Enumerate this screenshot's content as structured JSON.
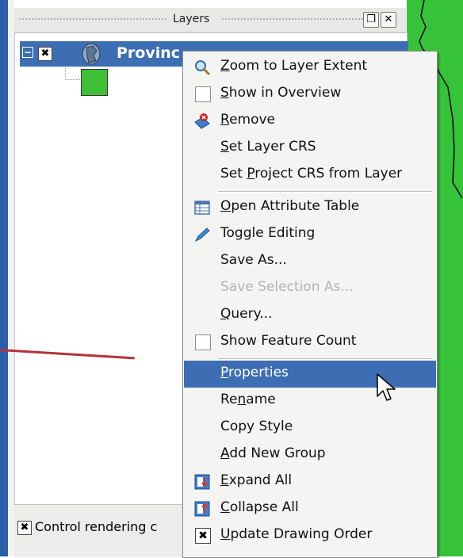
{
  "dock": {
    "title": "Layers",
    "float_glyph": "❐",
    "close_glyph": "✕"
  },
  "layer": {
    "name": "Provinc",
    "collapse_glyph": "−",
    "check_glyph": "✖",
    "icon": "vector-polygon-icon",
    "symbol_color": "#3fbe36"
  },
  "bottom": {
    "control_label": "Control rendering c",
    "check_glyph": "✖"
  },
  "colors": {
    "selection": "#3d6eb3",
    "map_green": "#36c33a",
    "red_line": "#b5323a"
  },
  "menu": {
    "items": [
      {
        "pre": "",
        "u": "Z",
        "post": "oom to Layer Extent",
        "icon": "zoom-extent-icon"
      },
      {
        "pre": "",
        "u": "S",
        "post": "how in Overview",
        "icon": "checkbox-icon"
      },
      {
        "pre": "",
        "u": "R",
        "post": "emove",
        "icon": "remove-layer-icon"
      },
      {
        "pre": "",
        "u": "S",
        "post": "et Layer CRS",
        "icon": ""
      },
      {
        "pre": "Set ",
        "u": "P",
        "post": "roject CRS from Layer",
        "icon": ""
      },
      {
        "pre": "",
        "u": "O",
        "post": "pen Attribute Table",
        "icon": "attribute-table-icon"
      },
      {
        "pre": "Toggle Editing",
        "u": "",
        "post": "",
        "icon": "pencil-icon"
      },
      {
        "pre": "Save As...",
        "u": "",
        "post": "",
        "icon": ""
      },
      {
        "pre": "Save Selection As...",
        "u": "",
        "post": "",
        "icon": ""
      },
      {
        "pre": "",
        "u": "Q",
        "post": "uery...",
        "icon": ""
      },
      {
        "pre": "Show Feature Count",
        "u": "",
        "post": "",
        "icon": "checkbox-icon"
      },
      {
        "pre": "",
        "u": "P",
        "post": "roperties",
        "icon": ""
      },
      {
        "pre": "Re",
        "u": "n",
        "post": "ame",
        "icon": ""
      },
      {
        "pre": "Copy Style",
        "u": "",
        "post": "",
        "icon": ""
      },
      {
        "pre": "",
        "u": "A",
        "post": "dd New Group",
        "icon": ""
      },
      {
        "pre": "",
        "u": "E",
        "post": "xpand All",
        "icon": "expand-all-icon"
      },
      {
        "pre": "",
        "u": "C",
        "post": "ollapse All",
        "icon": "collapse-all-icon"
      },
      {
        "pre": "",
        "u": "U",
        "post": "pdate Drawing Order",
        "icon": "checked-box-icon",
        "check_glyph": "✖"
      }
    ]
  }
}
